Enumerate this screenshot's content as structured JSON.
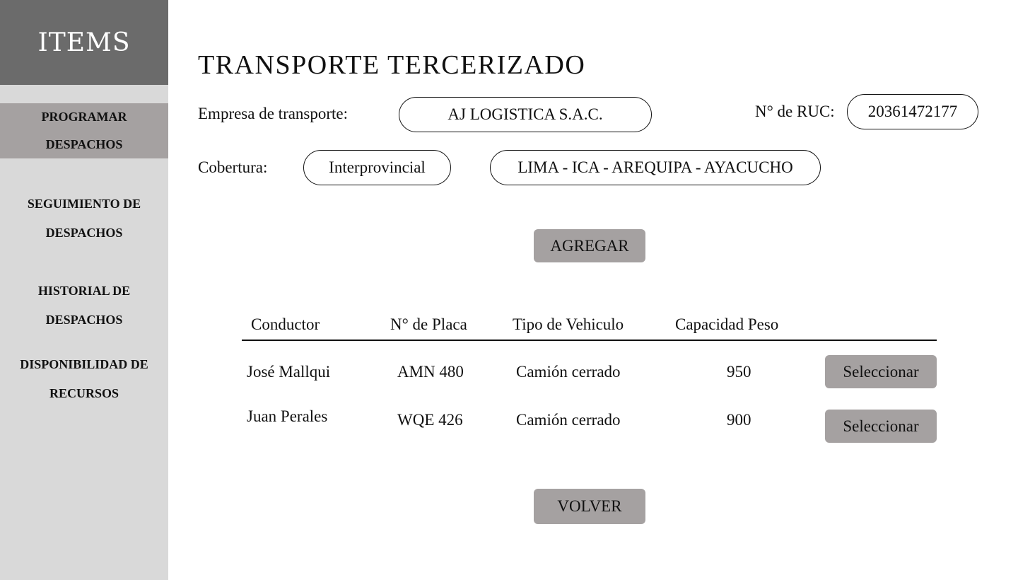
{
  "sidebar": {
    "header": "ITEMS",
    "items": [
      {
        "line1": "PROGRAMAR",
        "line2": "DESPACHOS",
        "active": true
      },
      {
        "line1": "SEGUIMIENTO DE",
        "line2": "DESPACHOS",
        "active": false
      },
      {
        "line1": "HISTORIAL DE",
        "line2": "DESPACHOS",
        "active": false
      },
      {
        "line1": "DISPONIBILIDAD DE",
        "line2": "RECURSOS",
        "active": false
      }
    ]
  },
  "main": {
    "title": "TRANSPORTE TERCERIZADO",
    "company_label": "Empresa de transporte:",
    "company_value": "AJ LOGISTICA S.A.C.",
    "ruc_label": "N° de RUC:",
    "ruc_value": "20361472177",
    "coverage_label": "Cobertura:",
    "coverage_type": "Interprovincial",
    "coverage_route": "LIMA - ICA - AREQUIPA - AYACUCHO",
    "add_label": "AGREGAR",
    "back_label": "VOLVER"
  },
  "table": {
    "columns": [
      "Conductor",
      "N° de Placa",
      "Tipo de Vehiculo",
      "Capacidad Peso"
    ],
    "rows": [
      {
        "driver": "José Mallqui",
        "plate": "AMN 480",
        "vehicle": "Camión cerrado",
        "capacity": "950",
        "action": "Seleccionar"
      },
      {
        "driver": "Juan Perales",
        "plate": "WQE 426",
        "vehicle": "Camión cerrado",
        "capacity": "900",
        "action": "Seleccionar"
      }
    ]
  },
  "colors": {
    "sidebar_bg": "#d9d9d9",
    "sidebar_header_bg": "#6b6b6b",
    "active_item_bg": "#a5a1a1",
    "button_bg": "#a5a1a1"
  }
}
